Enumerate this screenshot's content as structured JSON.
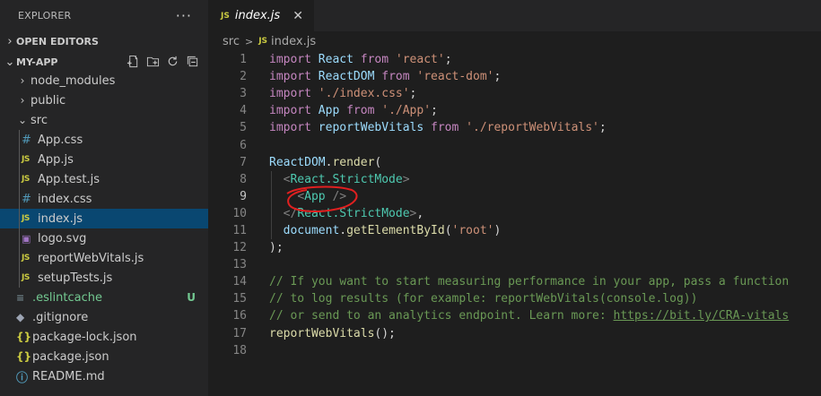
{
  "explorer": {
    "title": "EXPLORER",
    "more_label": "···",
    "open_editors_label": "OPEN EDITORS",
    "project_label": "MY-APP",
    "actions": [
      "new-file-icon",
      "new-folder-icon",
      "refresh-icon",
      "collapse-all-icon"
    ],
    "tree": [
      {
        "name": "node_modules",
        "type": "folder",
        "depth": 1,
        "expanded": false
      },
      {
        "name": "public",
        "type": "folder",
        "depth": 1,
        "expanded": false
      },
      {
        "name": "src",
        "type": "folder",
        "depth": 1,
        "expanded": true
      },
      {
        "name": "App.css",
        "type": "css",
        "depth": 2
      },
      {
        "name": "App.js",
        "type": "js",
        "depth": 2
      },
      {
        "name": "App.test.js",
        "type": "js",
        "depth": 2
      },
      {
        "name": "index.css",
        "type": "css",
        "depth": 2
      },
      {
        "name": "index.js",
        "type": "js",
        "depth": 2,
        "selected": true
      },
      {
        "name": "logo.svg",
        "type": "svg",
        "depth": 2
      },
      {
        "name": "reportWebVitals.js",
        "type": "js",
        "depth": 2
      },
      {
        "name": "setupTests.js",
        "type": "js",
        "depth": 2
      },
      {
        "name": ".eslintcache",
        "type": "lint",
        "depth": 1,
        "status": "U"
      },
      {
        "name": ".gitignore",
        "type": "git",
        "depth": 1
      },
      {
        "name": "package-lock.json",
        "type": "npm",
        "depth": 1
      },
      {
        "name": "package.json",
        "type": "npm",
        "depth": 1
      },
      {
        "name": "README.md",
        "type": "info",
        "depth": 1
      }
    ]
  },
  "tab": {
    "icon_label": "JS",
    "name": "index.js",
    "close": "✕"
  },
  "breadcrumb": {
    "folder": "src",
    "icon_label": "JS",
    "file": "index.js"
  },
  "code": {
    "current_line": 9,
    "lines": [
      {
        "n": "1",
        "parts": [
          [
            "kw",
            "import"
          ],
          [
            "pl",
            " "
          ],
          [
            "id",
            "React"
          ],
          [
            "pl",
            " "
          ],
          [
            "kw",
            "from"
          ],
          [
            "pl",
            " "
          ],
          [
            "str",
            "'react'"
          ],
          [
            "pl",
            ";"
          ]
        ]
      },
      {
        "n": "2",
        "parts": [
          [
            "kw",
            "import"
          ],
          [
            "pl",
            " "
          ],
          [
            "id",
            "ReactDOM"
          ],
          [
            "pl",
            " "
          ],
          [
            "kw",
            "from"
          ],
          [
            "pl",
            " "
          ],
          [
            "str",
            "'react-dom'"
          ],
          [
            "pl",
            ";"
          ]
        ]
      },
      {
        "n": "3",
        "parts": [
          [
            "kw",
            "import"
          ],
          [
            "pl",
            " "
          ],
          [
            "str",
            "'./index.css'"
          ],
          [
            "pl",
            ";"
          ]
        ]
      },
      {
        "n": "4",
        "parts": [
          [
            "kw",
            "import"
          ],
          [
            "pl",
            " "
          ],
          [
            "id",
            "App"
          ],
          [
            "pl",
            " "
          ],
          [
            "kw",
            "from"
          ],
          [
            "pl",
            " "
          ],
          [
            "str",
            "'./App'"
          ],
          [
            "pl",
            ";"
          ]
        ]
      },
      {
        "n": "5",
        "parts": [
          [
            "kw",
            "import"
          ],
          [
            "pl",
            " "
          ],
          [
            "id",
            "reportWebVitals"
          ],
          [
            "pl",
            " "
          ],
          [
            "kw",
            "from"
          ],
          [
            "pl",
            " "
          ],
          [
            "str",
            "'./reportWebVitals'"
          ],
          [
            "pl",
            ";"
          ]
        ]
      },
      {
        "n": "6",
        "parts": []
      },
      {
        "n": "7",
        "parts": [
          [
            "id",
            "ReactDOM"
          ],
          [
            "pl",
            "."
          ],
          [
            "fn",
            "render"
          ],
          [
            "pl",
            "("
          ]
        ]
      },
      {
        "n": "8",
        "parts": [
          [
            "pl",
            "  "
          ],
          [
            "br",
            "<"
          ],
          [
            "tag",
            "React.StrictMode"
          ],
          [
            "br",
            ">"
          ]
        ]
      },
      {
        "n": "9",
        "parts": [
          [
            "pl",
            "    "
          ],
          [
            "br",
            "<"
          ],
          [
            "tag",
            "App"
          ],
          [
            "pl",
            " "
          ],
          [
            "br",
            "/>"
          ]
        ]
      },
      {
        "n": "10",
        "parts": [
          [
            "pl",
            "  "
          ],
          [
            "br",
            "</"
          ],
          [
            "tag",
            "React.StrictMode"
          ],
          [
            "br",
            ">"
          ],
          [
            "pl",
            ","
          ]
        ]
      },
      {
        "n": "11",
        "parts": [
          [
            "pl",
            "  "
          ],
          [
            "id",
            "document"
          ],
          [
            "pl",
            "."
          ],
          [
            "fn",
            "getElementById"
          ],
          [
            "pl",
            "("
          ],
          [
            "str",
            "'root'"
          ],
          [
            "pl",
            ")"
          ]
        ]
      },
      {
        "n": "12",
        "parts": [
          [
            "pl",
            ");"
          ]
        ]
      },
      {
        "n": "13",
        "parts": []
      },
      {
        "n": "14",
        "parts": [
          [
            "cm",
            "// If you want to start measuring performance in your app, pass a function"
          ]
        ]
      },
      {
        "n": "15",
        "parts": [
          [
            "cm",
            "// to log results (for example: reportWebVitals(console.log))"
          ]
        ]
      },
      {
        "n": "16",
        "parts": [
          [
            "cm",
            "// or send to an analytics endpoint. Learn more: "
          ],
          [
            "lk",
            "https://bit.ly/CRA-vitals"
          ]
        ]
      },
      {
        "n": "17",
        "parts": [
          [
            "fn",
            "reportWebVitals"
          ],
          [
            "pl",
            "();"
          ]
        ]
      },
      {
        "n": "18",
        "parts": []
      }
    ]
  },
  "colors": {
    "editor_bg": "#1e1e1e",
    "sidebar_bg": "#252526",
    "selection": "#094771",
    "annotation": "#e02020"
  }
}
